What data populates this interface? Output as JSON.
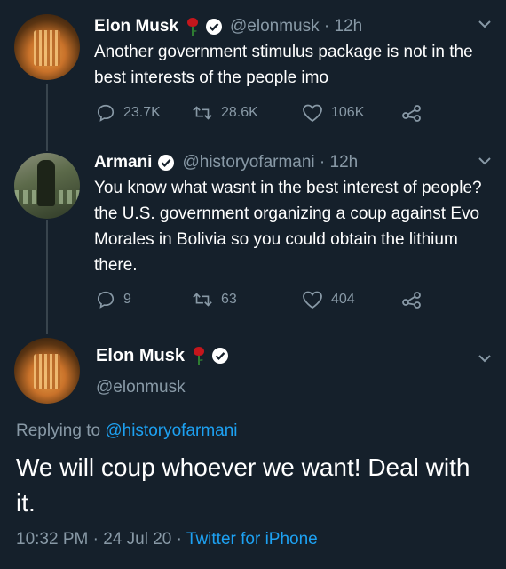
{
  "tweet1": {
    "name": "Elon Musk",
    "handle": "@elonmusk",
    "time": "12h",
    "text": "Another government stimulus package is not in the best interests of the people imo",
    "replies": "23.7K",
    "retweets": "28.6K",
    "likes": "106K"
  },
  "tweet2": {
    "name": "Armani",
    "handle": "@historyofarmani",
    "time": "12h",
    "text": "You know what wasnt in the best interest of people? the U.S. government organizing a coup against Evo Morales in Bolivia so you could obtain the lithium there.",
    "replies": "9",
    "retweets": "63",
    "likes": "404"
  },
  "main": {
    "name": "Elon Musk",
    "handle": "@elonmusk",
    "replying_prefix": "Replying to ",
    "replying_to": "@historyofarmani",
    "text": "We will coup whoever we want! Deal with it.",
    "time": "10:32 PM",
    "date": "24 Jul 20",
    "app": "Twitter for iPhone",
    "sep": " · "
  },
  "icons": {
    "verified": "verified-badge-icon",
    "rose": "rose-icon",
    "reply": "reply-icon",
    "retweet": "retweet-icon",
    "like": "heart-icon",
    "share": "share-icon",
    "caret": "chevron-down-icon"
  },
  "colors": {
    "background": "#15202b",
    "secondary_text": "#8899a6",
    "link": "#1da1f2",
    "rose": "#c4161c"
  }
}
